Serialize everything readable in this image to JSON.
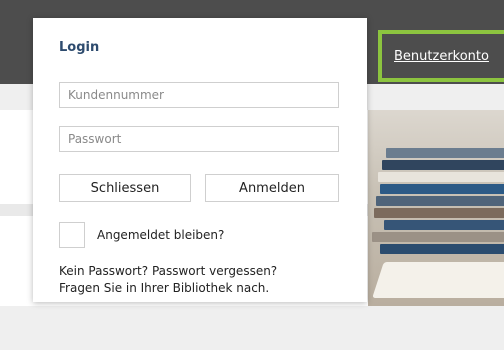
{
  "header": {
    "account_link": "Benutzerkonto"
  },
  "login_popup": {
    "title": "Login",
    "customer_number_placeholder": "Kundennummer",
    "password_placeholder": "Passwort",
    "close_button": "Schliessen",
    "login_button": "Anmelden",
    "remember_label": "Angemeldet bleiben?",
    "hint_line1": "Kein Passwort? Passwort vergessen?",
    "hint_line2": "Fragen Sie in Ihrer Bibliothek nach."
  },
  "colors": {
    "header_bg": "#4d4d4d",
    "accent_green": "#8cc43f",
    "title_blue": "#2d4b6e"
  }
}
